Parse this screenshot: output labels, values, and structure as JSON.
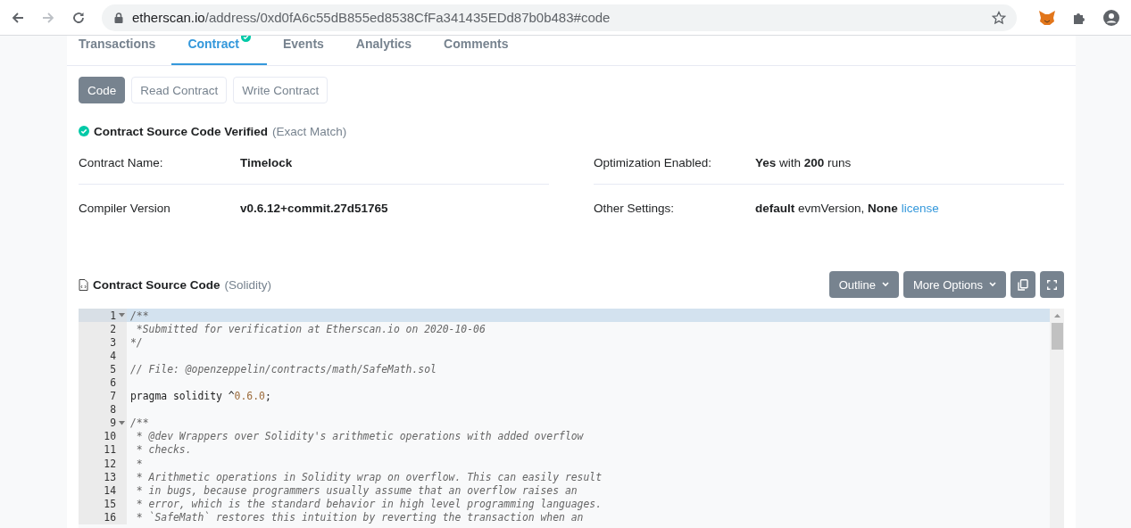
{
  "browser": {
    "url_host": "etherscan.io",
    "url_path": "/address/0xd0fA6c55dB855ed8538CfFa341435EDd87b0b483#code",
    "forward_disabled": true
  },
  "tabs": [
    {
      "label": "Transactions",
      "selected": false,
      "verified": false
    },
    {
      "label": "Contract",
      "selected": true,
      "verified": true
    },
    {
      "label": "Events",
      "selected": false,
      "verified": false
    },
    {
      "label": "Analytics",
      "selected": false,
      "verified": false
    },
    {
      "label": "Comments",
      "selected": false,
      "verified": false
    }
  ],
  "subtabs": [
    {
      "label": "Code",
      "selected": true
    },
    {
      "label": "Read Contract",
      "selected": false
    },
    {
      "label": "Write Contract",
      "selected": false
    }
  ],
  "verified": {
    "title": "Contract Source Code Verified",
    "note": "(Exact Match)"
  },
  "details": [
    [
      {
        "label": "Contract Name:",
        "value": "**Timelock**"
      },
      {
        "label": "Optimization Enabled:",
        "value": "**Yes** with **200** runs"
      }
    ],
    [
      {
        "label": "Compiler Version",
        "value": "**v0.6.12+commit.27d51765**"
      },
      {
        "label": "Other Settings:",
        "value": "**default** evmVersion, **None**",
        "link": "license"
      }
    ]
  ],
  "source": {
    "title": "Contract Source Code",
    "note": "(Solidity)",
    "buttons": [
      "Outline",
      "More Options"
    ]
  },
  "code": [
    {
      "n": "1",
      "fold": true,
      "active": true,
      "parts": [
        {
          "kind": "comment",
          "text": "/**"
        }
      ]
    },
    {
      "n": "2",
      "fold": false,
      "active": false,
      "parts": [
        {
          "kind": "comment",
          "text": " *Submitted for verification at Etherscan.io on 2020-10-06"
        }
      ]
    },
    {
      "n": "3",
      "fold": false,
      "active": false,
      "parts": [
        {
          "kind": "comment",
          "text": "*/"
        }
      ]
    },
    {
      "n": "4",
      "fold": false,
      "active": false
    },
    {
      "n": "5",
      "fold": false,
      "active": false,
      "parts": [
        {
          "kind": "comment",
          "text": "// File: @openzeppelin/contracts/math/SafeMath.sol"
        }
      ]
    },
    {
      "n": "6",
      "fold": false,
      "active": false
    },
    {
      "n": "7",
      "fold": false,
      "active": false,
      "parts": [
        {
          "kind": "plain",
          "text": "pragma solidity ^"
        },
        {
          "kind": "number",
          "text": "0.6.0"
        },
        {
          "kind": "plain",
          "text": ";"
        }
      ]
    },
    {
      "n": "8",
      "fold": false,
      "active": false
    },
    {
      "n": "9",
      "fold": true,
      "active": false,
      "parts": [
        {
          "kind": "comment",
          "text": "/**"
        }
      ]
    },
    {
      "n": "10",
      "fold": false,
      "active": false,
      "parts": [
        {
          "kind": "comment",
          "text": " * @dev Wrappers over Solidity's arithmetic operations with added overflow"
        }
      ]
    },
    {
      "n": "11",
      "fold": false,
      "active": false,
      "parts": [
        {
          "kind": "comment",
          "text": " * checks."
        }
      ]
    },
    {
      "n": "12",
      "fold": false,
      "active": false,
      "parts": [
        {
          "kind": "comment",
          "text": " *"
        }
      ]
    },
    {
      "n": "13",
      "fold": false,
      "active": false,
      "parts": [
        {
          "kind": "comment",
          "text": " * Arithmetic operations in Solidity wrap on overflow. This can easily result"
        }
      ]
    },
    {
      "n": "14",
      "fold": false,
      "active": false,
      "parts": [
        {
          "kind": "comment",
          "text": " * in bugs, because programmers usually assume that an overflow raises an"
        }
      ]
    },
    {
      "n": "15",
      "fold": false,
      "active": false,
      "parts": [
        {
          "kind": "comment",
          "text": " * error, which is the standard behavior in high level programming languages."
        }
      ]
    },
    {
      "n": "16",
      "fold": false,
      "active": false,
      "parts": [
        {
          "kind": "comment",
          "text": " * `SafeMath` restores this intuition by reverting the transaction when an"
        }
      ]
    }
  ]
}
